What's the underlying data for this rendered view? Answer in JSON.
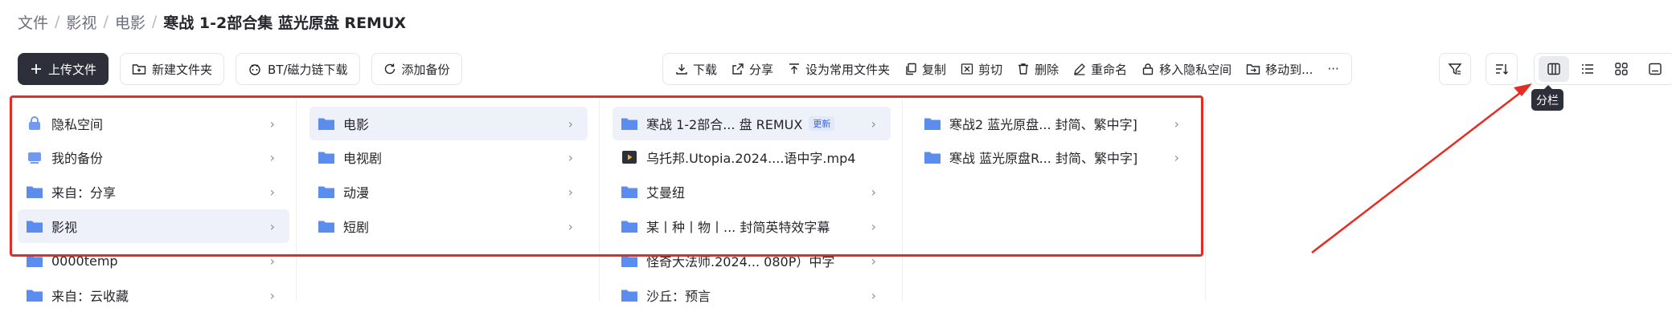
{
  "breadcrumb": {
    "items": [
      "文件",
      "影视",
      "电影"
    ],
    "current": "寒战 1-2部合集 蓝光原盘 REMUX"
  },
  "toolbar": {
    "upload": "上传文件",
    "new_folder": "新建文件夹",
    "bt_download": "BT/磁力链下载",
    "add_backup": "添加备份"
  },
  "actions": {
    "download": "下载",
    "share": "分享",
    "set_common": "设为常用文件夹",
    "copy": "复制",
    "cut": "剪切",
    "delete": "删除",
    "rename": "重命名",
    "move_private": "移入隐私空间",
    "move_to": "移动到...",
    "more": "···"
  },
  "tooltip": "分栏",
  "columns": {
    "col1": [
      "隐私空间",
      "我的备份",
      "来自：分享",
      "影视",
      "0000temp",
      "来自：云收藏"
    ],
    "col2": [
      "电影",
      "电视剧",
      "动漫",
      "短剧"
    ],
    "col3": [
      "寒战 1-2部合... 盘 REMUX",
      "乌托邦.Utopia.2024....语中字.mp4",
      "艾曼纽",
      "某丨种丨物丨... 封简英特效字幕",
      "怪奇大法师.2024... 080P）中字",
      "沙丘：预言"
    ],
    "col3_badge": "更新",
    "col4": [
      "寒战2 蓝光原盘... 封简、繁中字]",
      "寒战 蓝光原盘R... 封简、繁中字]"
    ]
  },
  "colors": {
    "accent": "#2d2f3a",
    "highlight": "#e52b22",
    "folder": "#5b8def",
    "selected": "#eef1fa"
  }
}
